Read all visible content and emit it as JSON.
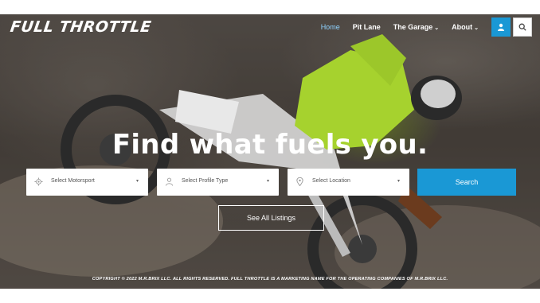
{
  "brand": {
    "logo_text": "FULL THROTTLE"
  },
  "nav": {
    "items": [
      {
        "label": "Home",
        "active": true
      },
      {
        "label": "Pit Lane",
        "active": false
      },
      {
        "label": "The Garage",
        "active": false,
        "dropdown": true
      },
      {
        "label": "About",
        "active": false,
        "dropdown": true
      }
    ],
    "user_icon": "user-icon",
    "search_icon": "search-icon"
  },
  "hero": {
    "headline": "Find what fuels you."
  },
  "filters": {
    "motorsport": {
      "label": "Select Motorsport",
      "icon": "gear-icon"
    },
    "profile_type": {
      "label": "Select Profile Type",
      "icon": "person-icon"
    },
    "location": {
      "label": "Select Location",
      "icon": "location-pin-icon"
    },
    "search_label": "Search"
  },
  "cta": {
    "all_listings": "See All Listings"
  },
  "footer": {
    "copyright": "COPYRIGHT © 2022 M.R.BRIX LLC. ALL RIGHTS RESERVED. FULL THROTTLE IS A MARKETING NAME FOR THE OPERATING COMPANIES OF M.R.BRIX LLC."
  },
  "colors": {
    "accent": "#1a98d5",
    "active_nav": "#8fd3ff",
    "jersey": "#a6d22e"
  }
}
